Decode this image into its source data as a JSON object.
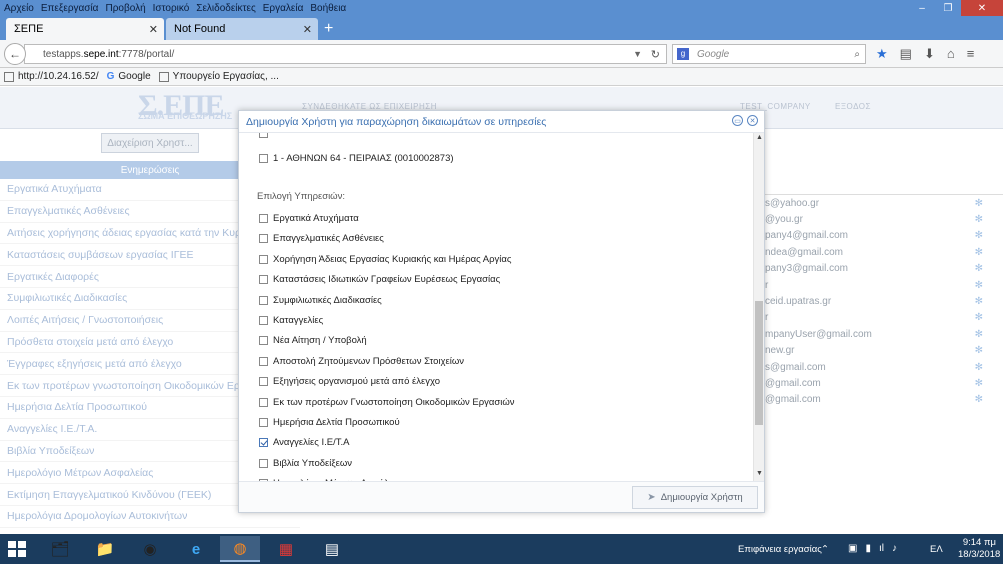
{
  "browser": {
    "menu": [
      "Αρχείο",
      "Επεξεργασία",
      "Προβολή",
      "Ιστορικό",
      "Σελιδοδείκτες",
      "Εργαλεία",
      "Βοήθεια"
    ],
    "tabs": [
      {
        "label": "ΣΕΠΕ",
        "active": true
      },
      {
        "label": "Not Found",
        "active": false
      }
    ],
    "url_prefix": "testapps.",
    "url_host": "sepe.int",
    "url_suffix": ":7778/portal/",
    "search_placeholder": "Google",
    "bookmarks": [
      {
        "label": "http://10.24.16.52/",
        "icon": "page-icon"
      },
      {
        "label": "Google",
        "icon": "google-icon"
      },
      {
        "label": "Υπουργείο Εργασίας, ...",
        "icon": "page-icon"
      }
    ]
  },
  "page": {
    "logo": "Σ.ΕΠΕ",
    "logo_sub": "ΣΩΜΑ ΕΠΙΘΕΩΡΗΣΗΣ",
    "header_links": [
      "ΣΥΝΔΕΘΗΚΑΤΕ ΩΣ ΕΠΙΧΕΙΡΗΣΗ",
      "TEST_COMPANY",
      "ΕΞΟΔΟΣ"
    ],
    "users_button": "Διαχείριση Χρηστ...",
    "sidebar_header": "Ενημερώσεις",
    "sidebar_items": [
      "Εργατικά Ατυχήματα",
      "Επαγγελματικές Ασθένειες",
      "Αιτήσεις χορήγησης άδειας εργασίας κατά την Κυριακή",
      "Καταστάσεις συμβάσεων εργασίας ΙΓΕΕ",
      "Εργατικές Διαφορές",
      "Συμφιλιωτικές Διαδικασίες",
      "Λοιπές Αιτήσεις / Γνωστοποιήσεις",
      "Πρόσθετα στοιχεία μετά από έλεγχο",
      "Έγγραφες εξηγήσεις μετά από έλεγχο",
      "Εκ των προτέρων γνωστοποίηση Οικοδομικών Εργασιών",
      "Ημερήσια Δελτία Προσωπικού",
      "Αναγγελίες Ι.Ε./Τ.Α.",
      "Βιβλία Υποδείξεων",
      "Ημερολόγιο Μέτρων Ασφαλείας",
      "Εκτίμηση Επαγγελματικού Κινδύνου (ΓΕΕΚ)",
      "Ημερολόγια Δρομολογίων Αυτοκινήτων"
    ],
    "emails": [
      "s@yahoo.gr",
      "@you.gr",
      "pany4@gmail.com",
      "ndea@gmail.com",
      "pany3@gmail.com",
      "r",
      "ceid.upatras.gr",
      "r",
      "mpanyUser@gmail.com",
      "new.gr",
      "s@gmail.com",
      "@gmail.com",
      "@gmail.com"
    ]
  },
  "modal": {
    "title": "Δημιουργία Χρήστη για παραχώρηση δικαιωμάτων σε υπηρεσίες",
    "branch": {
      "label": "1 - ΑΘΗΝΩΝ 64 - ΠΕΙΡΑΙΑΣ (0010002873)",
      "checked": false
    },
    "services_label": "Επιλογή Υπηρεσιών:",
    "services": [
      {
        "label": "Εργατικά Ατυχήματα",
        "checked": false
      },
      {
        "label": "Επαγγελματικές Ασθένειες",
        "checked": false
      },
      {
        "label": "Χορήγηση Άδειας Εργασίας Κυριακής και Ημέρας Αργίας",
        "checked": false
      },
      {
        "label": "Καταστάσεις Ιδιωτικών Γραφείων Ευρέσεως Εργασίας",
        "checked": false
      },
      {
        "label": "Συμφιλιωτικές Διαδικασίες",
        "checked": false
      },
      {
        "label": "Καταγγελίες",
        "checked": false
      },
      {
        "label": "Νέα Αίτηση / Υποβολή",
        "checked": false
      },
      {
        "label": "Αποστολή Ζητούμενων Πρόσθετων Στοιχείων",
        "checked": false
      },
      {
        "label": "Εξηγήσεις οργανισμού μετά από έλεγχο",
        "checked": false
      },
      {
        "label": "Εκ των προτέρων Γνωστοποίηση Οικοδομικών Εργασιών",
        "checked": false
      },
      {
        "label": "Ημερήσια Δελτία Προσωπικού",
        "checked": false
      },
      {
        "label": "Αναγγελίες Ι.Ε/Τ.Α",
        "checked": true
      },
      {
        "label": "Βιβλία Υποδείξεων",
        "checked": false
      },
      {
        "label": "Ημερολόγια Μέτρων Ασφάλειας",
        "checked": false
      }
    ],
    "create_button": "Δημιουργία Χρήστη"
  },
  "taskbar": {
    "desktop_label": "Επιφάνεια εργασίας",
    "language": "ΕΛ",
    "time": "9:14 πμ",
    "date": "18/3/2018",
    "apps": [
      "file-explorer-icon",
      "folder-icon",
      "chrome-icon",
      "ie-icon",
      "firefox-icon",
      "app-red-icon",
      "document-icon"
    ]
  },
  "colors": {
    "titlebar": "#5a8fd0",
    "modal_title": "#3a6fb0",
    "taskbar": "#1b3c5e"
  }
}
